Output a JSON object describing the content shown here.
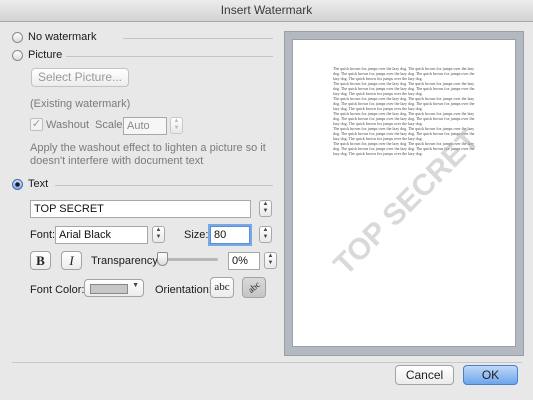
{
  "window": {
    "title": "Insert Watermark"
  },
  "options": {
    "no_watermark": "No watermark",
    "picture": "Picture",
    "text": "Text"
  },
  "picture_section": {
    "select_picture_button": "Select Picture...",
    "existing_watermark": "(Existing watermark)",
    "washout_label": "Washout",
    "washout_checked": true,
    "scale_label": "Scale:",
    "scale_value": "Auto",
    "help_text": "Apply the washout effect to lighten a picture so it doesn't interfere with document text"
  },
  "text_section": {
    "text_value": "TOP SECRET",
    "font_label": "Font:",
    "font_value": "Arial Black",
    "size_label": "Size:",
    "size_value": "80",
    "bold_label": "B",
    "italic_label": "I",
    "transparency_label": "Transparency:",
    "transparency_value": "0%",
    "transparency_level": 0,
    "font_color_label": "Font Color:",
    "font_color_value": "#c7c7c7",
    "orientation_label": "Orientation:",
    "orientation_horizontal": "abc",
    "orientation_diagonal": "abc"
  },
  "preview": {
    "watermark_text": "TOP SECRET",
    "paragraphs": [
      "The quick brown fox jumps over the lazy dog. The quick brown fox jumps over the lazy dog. The quick brown fox jumps over the lazy dog. The quick brown fox jumps over the lazy dog. The quick brown fox jumps over the lazy dog.",
      "The quick brown fox jumps over the lazy dog. The quick brown fox jumps over the lazy dog. The quick brown fox jumps over the lazy dog. The quick brown fox jumps over the lazy dog. The quick brown fox jumps over the lazy dog.",
      "The quick brown fox jumps over the lazy dog. The quick brown fox jumps over the lazy dog. The quick brown fox jumps over the lazy dog. The quick brown fox jumps over the lazy dog. The quick brown fox jumps over the lazy dog.",
      "The quick brown fox jumps over the lazy dog. The quick brown fox jumps over the lazy dog. The quick brown fox jumps over the lazy dog. The quick brown fox jumps over the lazy dog. The quick brown fox jumps over the lazy dog.",
      "The quick brown fox jumps over the lazy dog. The quick brown fox jumps over the lazy dog. The quick brown fox jumps over the lazy dog. The quick brown fox jumps over the lazy dog. The quick brown fox jumps over the lazy dog.",
      "The quick brown fox jumps over the lazy dog. The quick brown fox jumps over the lazy dog. The quick brown fox jumps over the lazy dog. The quick brown fox jumps over the lazy dog. The quick brown fox jumps over the lazy dog."
    ]
  },
  "buttons": {
    "cancel": "Cancel",
    "ok": "OK"
  },
  "colors": {
    "accent": "#3b82e6",
    "dialog_bg": "#e8e8e8",
    "preview_frame": "#b4b8c0"
  }
}
